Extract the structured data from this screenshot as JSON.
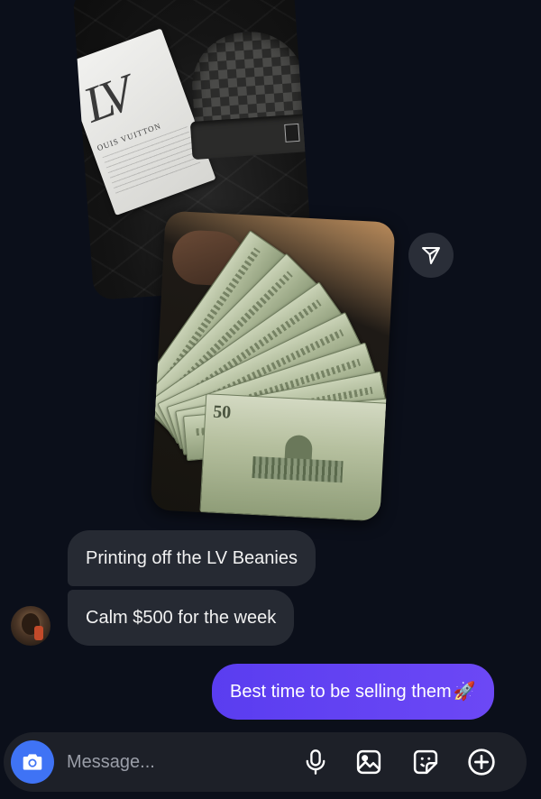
{
  "photos": {
    "back_card_brand_text": "OUIS VUITTON",
    "back_card_logo_text": "LV",
    "front_bill_denomination": "50"
  },
  "share": {
    "icon": "send-icon"
  },
  "messages": {
    "incoming": [
      {
        "text": "Printing off the LV Beanies"
      },
      {
        "text": "Calm $500 for the week"
      }
    ],
    "outgoing": [
      {
        "text": "Best time to be selling them",
        "emoji": "🚀"
      }
    ]
  },
  "composer": {
    "placeholder": "Message...",
    "value": "",
    "icons": [
      "camera-icon",
      "microphone-icon",
      "gallery-icon",
      "sticker-icon",
      "plus-icon"
    ]
  },
  "colors": {
    "background": "#0b0f1a",
    "incoming_bubble": "#262a33",
    "outgoing_bubble": "#5a3df0",
    "camera_button": "#3f73f5",
    "composer_bg": "#1d2028"
  }
}
